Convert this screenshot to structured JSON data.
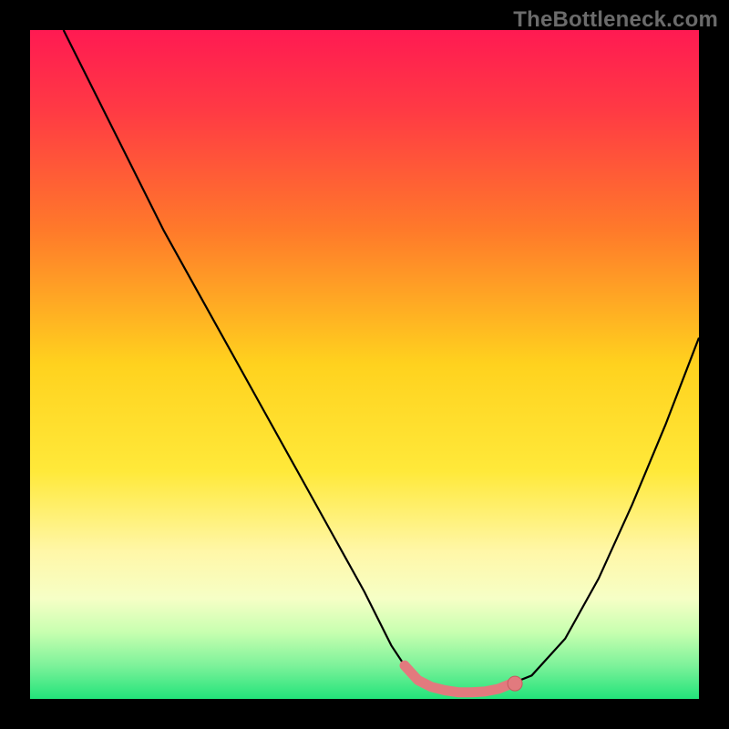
{
  "watermark": "TheBottleneck.com",
  "colors": {
    "background": "#000000",
    "curve": "#000000",
    "marker_fill": "#e27a7e",
    "marker_stroke": "#c65a5f",
    "gradient_stops": [
      {
        "offset": 0.0,
        "color": "#ff1a52"
      },
      {
        "offset": 0.12,
        "color": "#ff3a44"
      },
      {
        "offset": 0.3,
        "color": "#ff7a2a"
      },
      {
        "offset": 0.5,
        "color": "#ffd21e"
      },
      {
        "offset": 0.66,
        "color": "#ffe93a"
      },
      {
        "offset": 0.78,
        "color": "#fff7a8"
      },
      {
        "offset": 0.85,
        "color": "#f6ffc6"
      },
      {
        "offset": 0.9,
        "color": "#c8ffb0"
      },
      {
        "offset": 0.95,
        "color": "#7df29a"
      },
      {
        "offset": 1.0,
        "color": "#22e37a"
      }
    ]
  },
  "chart_data": {
    "type": "line",
    "title": "",
    "xlabel": "",
    "ylabel": "",
    "xlim": [
      0,
      100
    ],
    "ylim": [
      0,
      100
    ],
    "x": [
      5,
      10,
      15,
      20,
      25,
      30,
      35,
      40,
      45,
      50,
      54,
      56,
      58,
      60,
      62,
      64,
      66,
      68,
      70,
      75,
      80,
      85,
      90,
      95,
      100
    ],
    "values": [
      100,
      90,
      80,
      70,
      61,
      52,
      43,
      34,
      25,
      16,
      8,
      5,
      2.8,
      1.8,
      1.3,
      1.0,
      1.0,
      1.1,
      1.5,
      3.5,
      9,
      18,
      29,
      41,
      54
    ],
    "flat_region": {
      "x_start": 56,
      "x_end": 72,
      "approx_y": 1.2
    },
    "end_marker": {
      "x": 72.5,
      "y": 2.3
    },
    "note": "Values are read off the figure by vertical position within the gradient panel; 0 = bottom (green), 100 = top (red)."
  }
}
